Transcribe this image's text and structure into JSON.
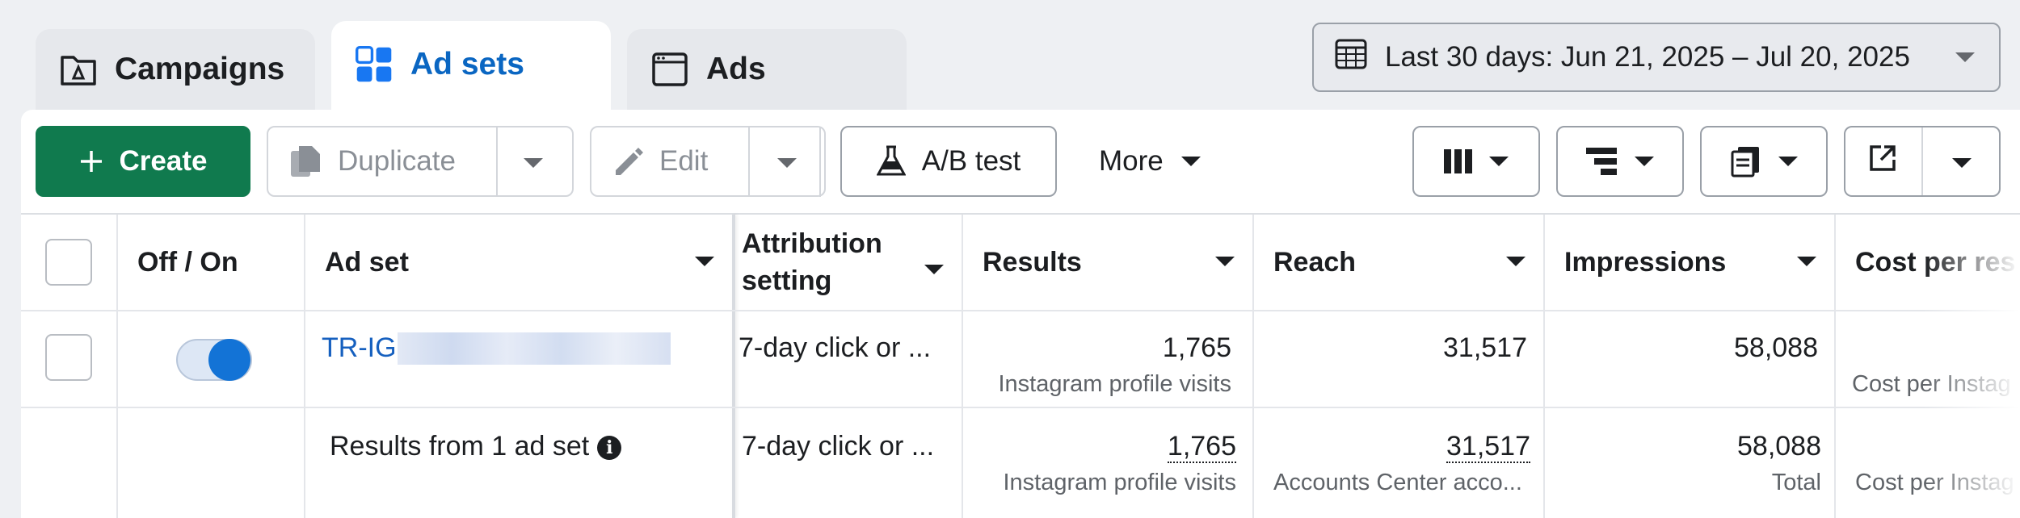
{
  "tabs": [
    {
      "label": "Campaigns",
      "icon": "flag-folder-icon",
      "active": false
    },
    {
      "label": "Ad sets",
      "icon": "grid-icon",
      "active": true
    },
    {
      "label": "Ads",
      "icon": "browser-window-icon",
      "active": false
    }
  ],
  "date_range": {
    "label": "Last 30 days: Jun 21, 2025 – Jul 20, 2025",
    "icon": "calendar-icon"
  },
  "toolbar": {
    "create": "Create",
    "duplicate": "Duplicate",
    "edit": "Edit",
    "ab_test": "A/B test",
    "more": "More"
  },
  "columns": {
    "onoff": "Off / On",
    "adset": "Ad set",
    "attribution_1": "Attribution",
    "attribution_2": "setting",
    "results": "Results",
    "reach": "Reach",
    "impressions": "Impressions",
    "cost": "Cost per res"
  },
  "rows": [
    {
      "name": "TR-IG",
      "attribution": "7-day click or ...",
      "results": "1,765",
      "results_sub": "Instagram profile visits",
      "reach": "31,517",
      "impressions": "58,088",
      "cost_sub": "Cost per Instag"
    }
  ],
  "summary": {
    "label": "Results from 1 ad set",
    "attribution": "7-day click or ...",
    "results": "1,765",
    "results_sub": "Instagram profile visits",
    "reach": "31,517",
    "reach_sub": "Accounts Center acco...",
    "impressions": "58,088",
    "impressions_sub": "Total",
    "cost_sub": "Cost per Instag"
  },
  "colors": {
    "accent": "#0a66c2",
    "create": "#107a4e",
    "toggle": "#1373d6"
  }
}
